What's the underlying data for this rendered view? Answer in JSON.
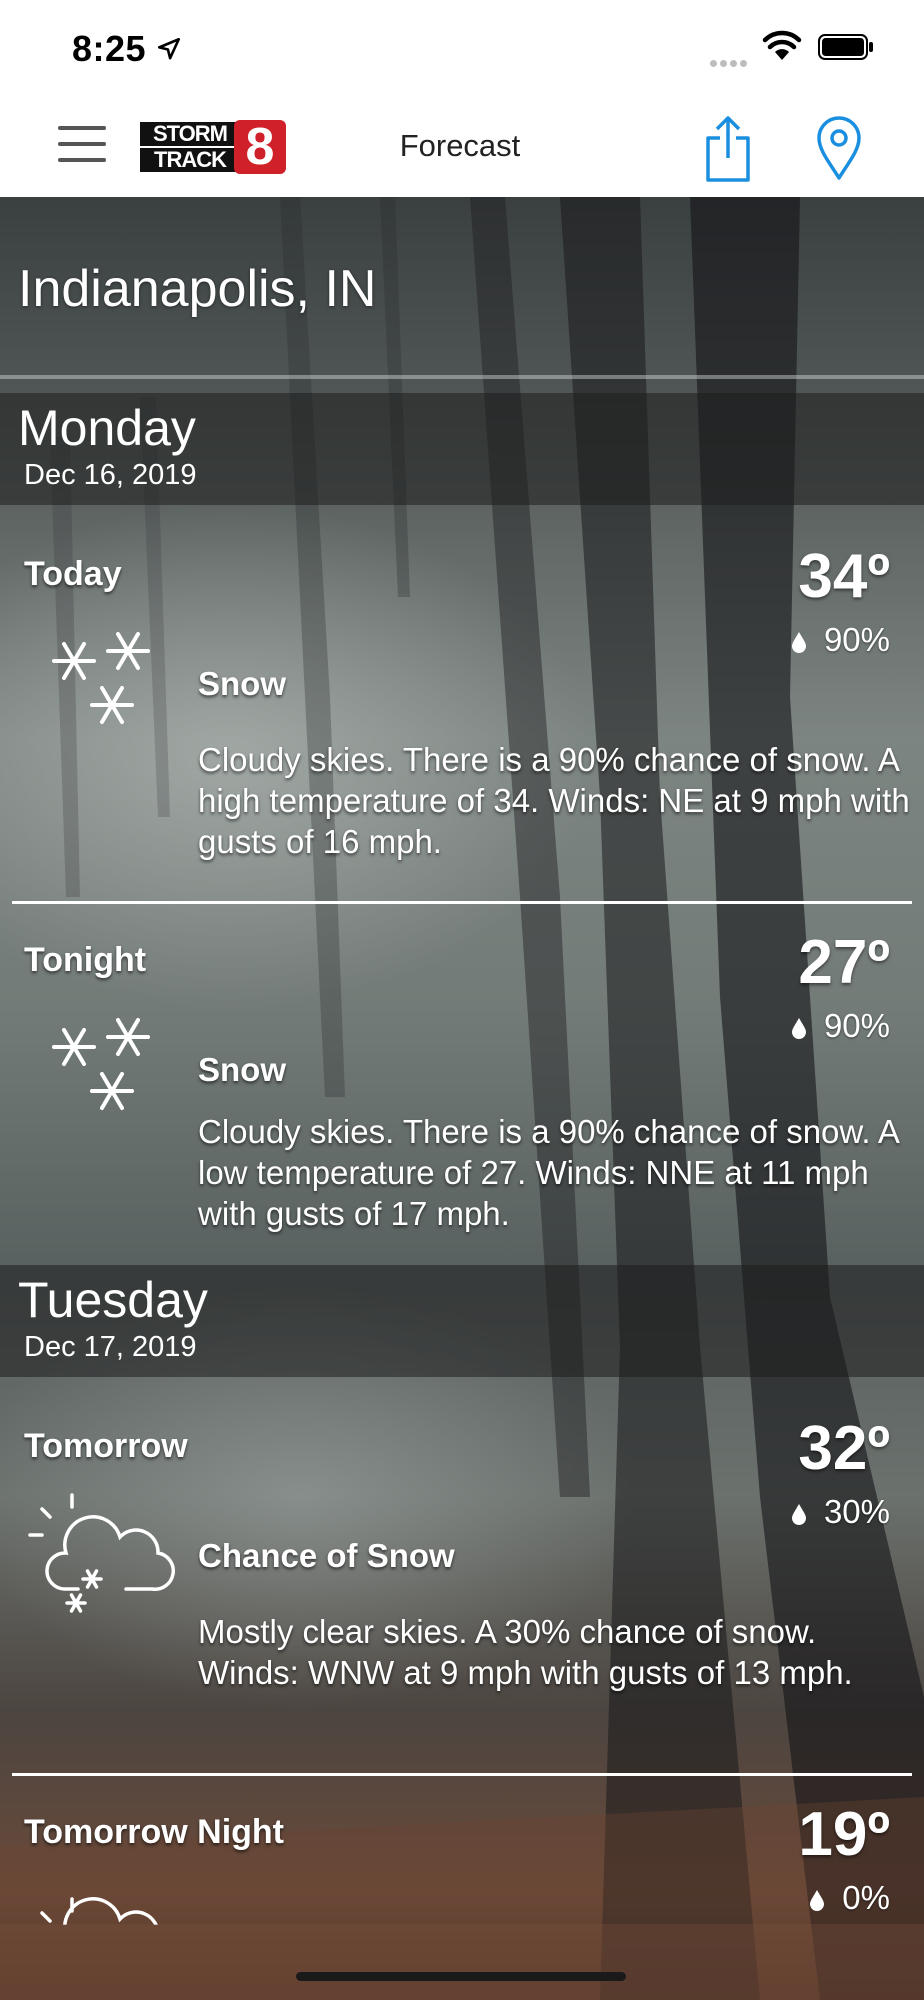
{
  "status_bar": {
    "time": "8:25"
  },
  "nav": {
    "title": "Forecast",
    "logo_line1": "STORM",
    "logo_line2": "TRACK",
    "logo_number": "8"
  },
  "location": {
    "city": "Indianapolis, IN"
  },
  "days": [
    {
      "name": "Monday",
      "date": "Dec 16, 2019",
      "periods": [
        {
          "label": "Today",
          "temp": "34º",
          "precip": "90%",
          "icon": "snow-icon",
          "condition": "Snow",
          "description": "Cloudy skies. There is a 90% chance of snow.  A high temperature of 34.  Winds: NE at 9 mph with gusts of 16 mph."
        },
        {
          "label": "Tonight",
          "temp": "27º",
          "precip": "90%",
          "icon": "snow-icon",
          "condition": "Snow",
          "description": "Cloudy skies. There is a 90% chance of snow.  A low temperature of 27.  Winds: NNE at 11 mph with gusts of 17 mph."
        }
      ]
    },
    {
      "name": "Tuesday",
      "date": "Dec 17, 2019",
      "periods": [
        {
          "label": "Tomorrow",
          "temp": "32º",
          "precip": "30%",
          "icon": "partly-cloudy-snow-icon",
          "condition": "Chance of Snow",
          "description": "Mostly clear skies.  A 30% chance of snow.  Winds: WNW at 9 mph with gusts of 13 mph."
        },
        {
          "label": "Tomorrow Night",
          "temp": "19º",
          "precip": "0%",
          "icon": "partly-cloudy-icon"
        }
      ]
    }
  ],
  "colors": {
    "accent": "#1a8fe0",
    "logo_red": "#d0202a",
    "header_overlay": "#1e1e1e"
  }
}
